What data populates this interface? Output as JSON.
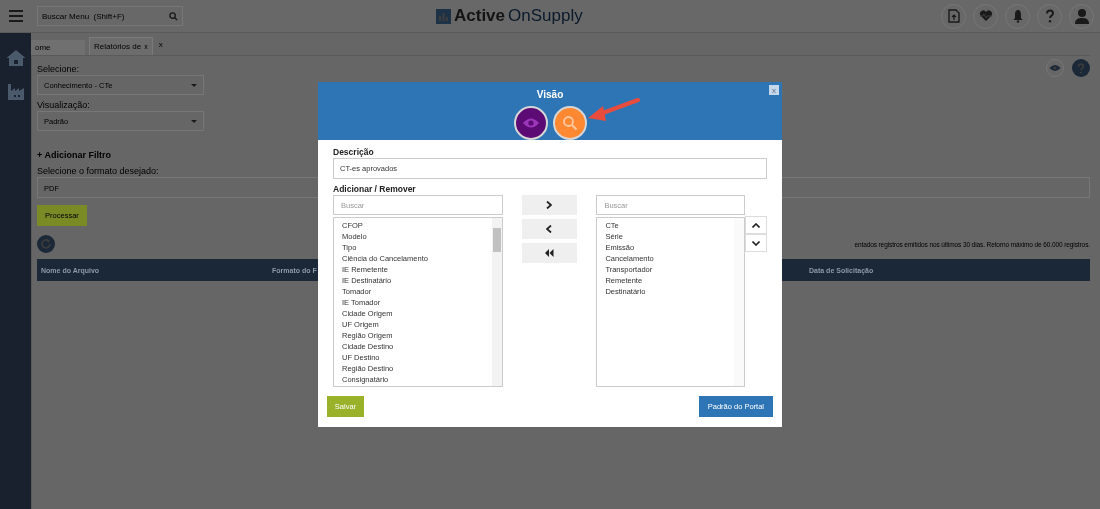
{
  "topbar": {
    "search_placeholder": "Buscar Menu  (Shift+F)",
    "logo": {
      "bold": "Active",
      "light": "OnSupply"
    }
  },
  "tabs": [
    {
      "label": "ome",
      "selected": false
    },
    {
      "label": "Relatórios de",
      "selected": true,
      "close": "x"
    }
  ],
  "tabs_close_all": "x",
  "form": {
    "select_label": "Selecione:",
    "select_value": "Conhecimento - CTe",
    "view_label": "Visualização:",
    "view_value": "Padrão",
    "add_filter": "+ Adicionar Filtro",
    "format_label": "Selecione o formato desejado:",
    "format_value": "PDF",
    "process_button": "Processar",
    "info": "entados registros emitidos nos últimos 30 dias. Retorno máximo de 60.000 registros."
  },
  "table": {
    "columns": [
      "Nome do Arquivo",
      "Formato do F",
      "Data de Solicitação"
    ]
  },
  "modal": {
    "title": "Visão",
    "close": "x",
    "description_label": "Descrição",
    "description_value": "CT-es aprovados",
    "add_remove_label": "Adicionar / Remover",
    "available": {
      "placeholder": "Buscar",
      "items": [
        "CFOP",
        "Modelo",
        "Tipo",
        "Ciência do Cancelamento",
        "IE Remetente",
        "IE Destinatário",
        "Tomador",
        "IE Tomador",
        "Cidade Origem",
        "UF Origem",
        "Região Origem",
        "Cidade Destino",
        "UF Destino",
        "Região Destino",
        "Consignatário"
      ]
    },
    "selected": {
      "placeholder": "Buscar",
      "items": [
        "CTe",
        "Série",
        "Emissão",
        "Cancelamento",
        "Transportador",
        "Remetente",
        "Destinatário"
      ]
    },
    "save_button": "Salvar",
    "default_button": "Padrão do Portal"
  }
}
